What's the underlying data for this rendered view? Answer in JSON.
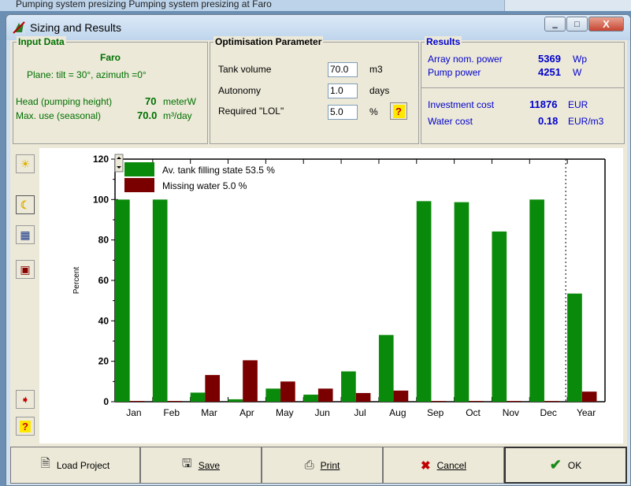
{
  "background_window": {
    "title": "Pumping system presizing   Pumping system presizing  at  Faro"
  },
  "window": {
    "title": "Sizing and Results",
    "minimize": "‗",
    "maximize": "□",
    "close": "X"
  },
  "input_data": {
    "heading": "Input Data",
    "site": "Faro",
    "plane": "Plane: tilt = 30°, azimuth =0°",
    "head_label": "Head (pumping height)",
    "head_value": "70",
    "head_unit": "meterW",
    "max_use_label": "Max. use (seasonal)",
    "max_use_value": "70.0",
    "max_use_unit": "m³/day"
  },
  "optimisation": {
    "heading": "Optimisation Parameter",
    "tank_label": "Tank volume",
    "tank_value": "70.0",
    "tank_unit": "m3",
    "autonomy_label": "Autonomy",
    "autonomy_value": "1.0",
    "autonomy_unit": "days",
    "lol_label": "Required  \"LOL\"",
    "lol_value": "5.0",
    "lol_unit": "%",
    "help": "?"
  },
  "results": {
    "heading": "Results",
    "array_label": "Array nom. power",
    "array_value": "5369",
    "array_unit": "Wp",
    "pump_label": "Pump power",
    "pump_value": "4251",
    "pump_unit": "W",
    "invest_label": "Investment cost",
    "invest_value": "11876",
    "invest_unit": "EUR",
    "water_label": "Water cost",
    "water_value": "0.18",
    "water_unit": "EUR/m3"
  },
  "side_toolbar": {
    "icons": [
      "sun-icon",
      "moon-icon",
      "table-icon",
      "palette-icon",
      "export-icon",
      "help-icon"
    ],
    "help": "?"
  },
  "colors": {
    "filling": "#0a8a0a",
    "missing": "#7a0000",
    "accent": "#0000cc"
  },
  "chart_data": {
    "type": "bar",
    "ylabel": "Percent",
    "ylim": [
      0,
      120
    ],
    "yticks": [
      "0",
      "20",
      "40",
      "60",
      "80",
      "100",
      "120"
    ],
    "categories": [
      "Jan",
      "Feb",
      "Mar",
      "Apr",
      "May",
      "Jun",
      "Jul",
      "Aug",
      "Sep",
      "Oct",
      "Nov",
      "Dec",
      "Year"
    ],
    "series": [
      {
        "name": "Av. tank filling state  53.5 %",
        "values": [
          100,
          100,
          4.5,
          1.2,
          6.5,
          3.5,
          15,
          33,
          99.2,
          98.7,
          84.2,
          100,
          53.5
        ]
      },
      {
        "name": "Missing water  5.0 %",
        "values": [
          0,
          0,
          13.2,
          20.5,
          10,
          6.5,
          4.3,
          5.5,
          0,
          0,
          0,
          0,
          5.0
        ]
      }
    ],
    "grid": false,
    "legend_position": "top-left"
  },
  "buttons": {
    "load": "Load Project",
    "save": "Save",
    "print": "Print",
    "cancel": "Cancel",
    "ok": "OK"
  }
}
